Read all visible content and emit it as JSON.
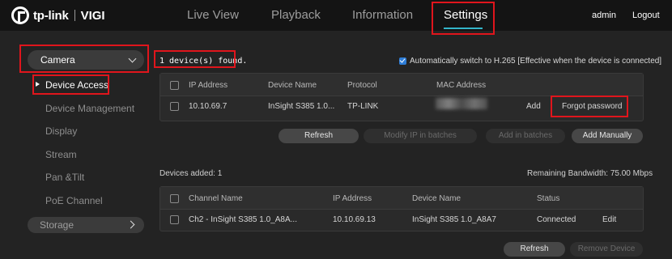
{
  "header": {
    "logo_text": "tp-link",
    "brand": "VIGI",
    "nav": [
      "Live View",
      "Playback",
      "Information",
      "Settings"
    ],
    "user": "admin",
    "logout": "Logout"
  },
  "sidebar": {
    "category": "Camera",
    "items": [
      "Device Access",
      "Device Management",
      "Display",
      "Stream",
      "Pan &Tilt",
      "PoE Channel"
    ],
    "storage": "Storage"
  },
  "discover": {
    "found": "1 device(s) found.",
    "auto_switch": "Automatically switch to H.265 [Effective when the device is connected]",
    "columns": [
      "IP Address",
      "Device Name",
      "Protocol",
      "MAC Address"
    ],
    "row": {
      "ip": "10.10.69.7",
      "name": "InSight S385 1.0...",
      "protocol": "TP-LINK",
      "add": "Add",
      "forgot": "Forgot password"
    },
    "buttons": {
      "refresh": "Refresh",
      "modify_ip": "Modify IP in batches",
      "add_batches": "Add in batches",
      "add_manually": "Add Manually"
    }
  },
  "added": {
    "label": "Devices added: 1",
    "bandwidth": "Remaining Bandwidth: 75.00 Mbps",
    "columns": [
      "Channel Name",
      "IP Address",
      "Device Name",
      "Status"
    ],
    "row": {
      "channel": "Ch2 - InSight S385 1.0_A8A...",
      "ip": "10.10.69.13",
      "name": "InSight S385 1.0_A8A7",
      "status": "Connected",
      "edit": "Edit"
    },
    "buttons": {
      "refresh": "Refresh",
      "remove": "Remove Device"
    }
  },
  "colors": {
    "accent": "#33b5c9",
    "highlight": "#e0151c",
    "background": "#232323"
  }
}
